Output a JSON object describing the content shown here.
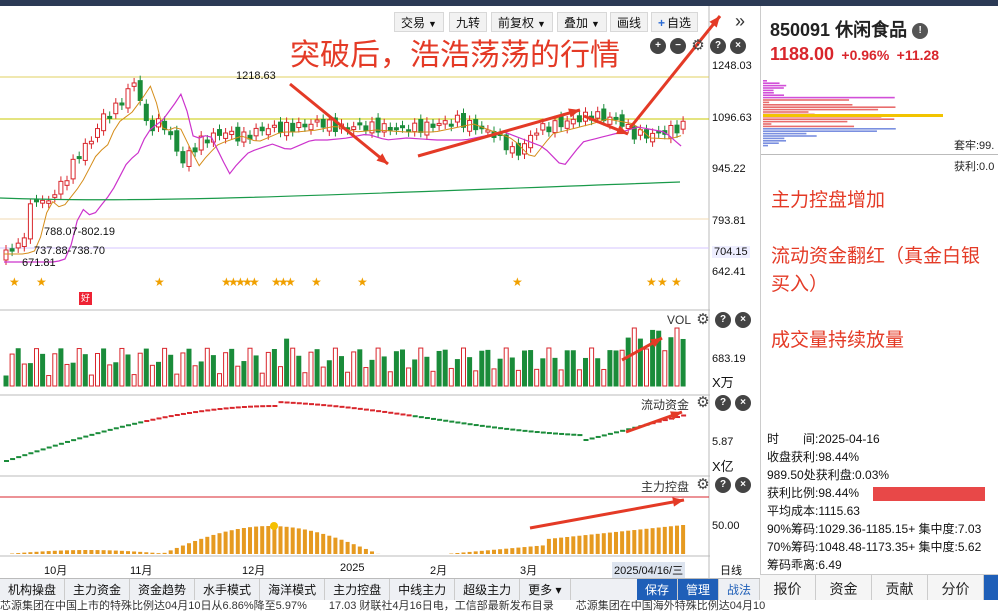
{
  "toolbar": {
    "trade": "交易",
    "jiuzhuan": "九转",
    "fq": "前复权",
    "overlay": "叠加",
    "draw": "画线",
    "zixuan": "自选"
  },
  "headline": "突破后，浩浩荡荡的行情",
  "stock": {
    "code": "850091",
    "name": "休闲食品",
    "price": "1188.00",
    "pct": "+0.96%",
    "chg": "+11.28"
  },
  "right_labels": {
    "pct_a": "套牢:99.",
    "pct_b": "获利:0.0"
  },
  "annotations": {
    "a1": "主力控盘增加",
    "a2": "流动资金翻红（真金白银买入）",
    "a3": "成交量持续放量"
  },
  "price_axis": [
    "1248.03",
    "1096.63",
    "945.22",
    "793.81",
    "704.15",
    "642.41"
  ],
  "price_marks": {
    "high": "1218.63",
    "low": "671.81",
    "range1": "788.07-802.19",
    "range2": "737.88-738.70"
  },
  "hao_badge": "好",
  "vol_panel": {
    "title": "VOL",
    "value": "683.19",
    "unit": "X万"
  },
  "flow_panel": {
    "title": "流动资金",
    "value": "5.87",
    "unit": "X亿"
  },
  "ctrl_panel": {
    "title": "主力控盘",
    "value": "50.00"
  },
  "date_axis": [
    "10月",
    "11月",
    "12月",
    "2025",
    "2月",
    "3月",
    "2025/04/16/三",
    "日线"
  ],
  "chip": {
    "time": "时　　间:2025-04-16",
    "profit": "收盘获利:98.44%",
    "profit2": "989.50处获利盘:0.03%",
    "ratio": "获利比例:98.44%",
    "avg": "平均成本:1115.63",
    "c90": "90%筹码:1029.36-1185.15+ 集中度:7.03",
    "c70": "70%筹码:1048.48-1173.35+ 集中度:5.62",
    "dev": "筹码乖离:6.49"
  },
  "bottom_tabs": [
    "机构操盘",
    "主力资金",
    "资金趋势",
    "水手模式",
    "海洋模式",
    "主力控盘",
    "中线主力",
    "超级主力",
    "更多"
  ],
  "bottom_right": [
    "保存",
    "管理",
    "战法"
  ],
  "right_tabs": [
    "报价",
    "资金",
    "贡献",
    "分价"
  ],
  "news": "芯源集团在中国上市的特殊比例达04月10日从6.86%降至5.97%　　17.03 财联社4月16日电，工信部最新发布目录　　芯源集团在中国海外特殊比例达04月10",
  "colors": {
    "up": "#d9262c",
    "down": "#1a8c3a",
    "ma": "#d58d1a",
    "ma2": "#cc33cc",
    "ma3": "#1a9a4a",
    "accent": "#e43a26"
  }
}
